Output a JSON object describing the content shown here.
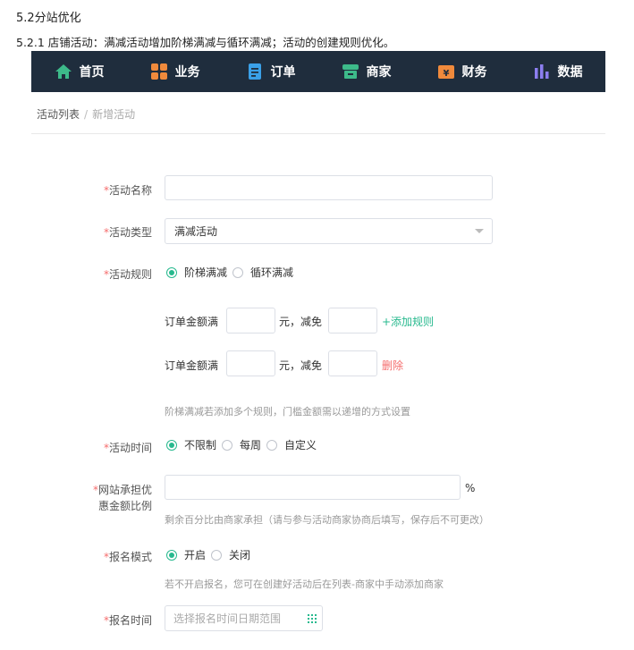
{
  "doc": {
    "section_title": "5.2分站优化",
    "subsection": "5.2.1 店铺活动：满减活动增加阶梯满减与循环满减；活动的创建规则优化。"
  },
  "nav": {
    "items": [
      {
        "label": "首页",
        "icon": "home-icon",
        "color": "#3dba8a"
      },
      {
        "label": "业务",
        "icon": "grid-icon",
        "color": "#f08a3c"
      },
      {
        "label": "订单",
        "icon": "document-icon",
        "color": "#3aa0e8"
      },
      {
        "label": "商家",
        "icon": "store-icon",
        "color": "#3dba8a"
      },
      {
        "label": "财务",
        "icon": "wallet-icon",
        "color": "#f08a3c"
      },
      {
        "label": "数据",
        "icon": "bar-chart-icon",
        "color": "#8c7ef0"
      }
    ]
  },
  "breadcrumb": {
    "parent": "活动列表",
    "separator": "/",
    "current": "新增活动"
  },
  "form": {
    "required_mark": "*",
    "name": {
      "label": "活动名称",
      "value": ""
    },
    "type": {
      "label": "活动类型",
      "value": "满减活动"
    },
    "rule": {
      "label": "活动规则",
      "options": [
        {
          "label": "阶梯满减",
          "checked": true
        },
        {
          "label": "循环满减",
          "checked": false
        }
      ],
      "rows": [
        {
          "prefix": "订单金额满",
          "mid": "元，减免",
          "action": "+添加规则"
        },
        {
          "prefix": "订单金额满",
          "mid": "元，减免",
          "action": "删除"
        }
      ],
      "hint": "阶梯满减若添加多个规则，门槛金额需以递增的方式设置"
    },
    "time": {
      "label": "活动时间",
      "options": [
        {
          "label": "不限制",
          "checked": true
        },
        {
          "label": "每周",
          "checked": false
        },
        {
          "label": "自定义",
          "checked": false
        }
      ]
    },
    "ratio": {
      "label_line1": "网站承担优",
      "label_line2": "惠金额比例",
      "unit": "%",
      "hint": "剩余百分比由商家承担（请与参与活动商家协商后填写，保存后不可更改）"
    },
    "signup": {
      "label": "报名模式",
      "options": [
        {
          "label": "开启",
          "checked": true
        },
        {
          "label": "关闭",
          "checked": false
        }
      ],
      "hint": "若不开启报名，您可在创建好活动后在列表-商家中手动添加商家"
    },
    "signup_time": {
      "label": "报名时间",
      "placeholder": "选择报名时间日期范围"
    }
  },
  "colors": {
    "accent": "#27b98e",
    "danger": "#f56c6c",
    "nav_bg": "#1f2d3d"
  }
}
